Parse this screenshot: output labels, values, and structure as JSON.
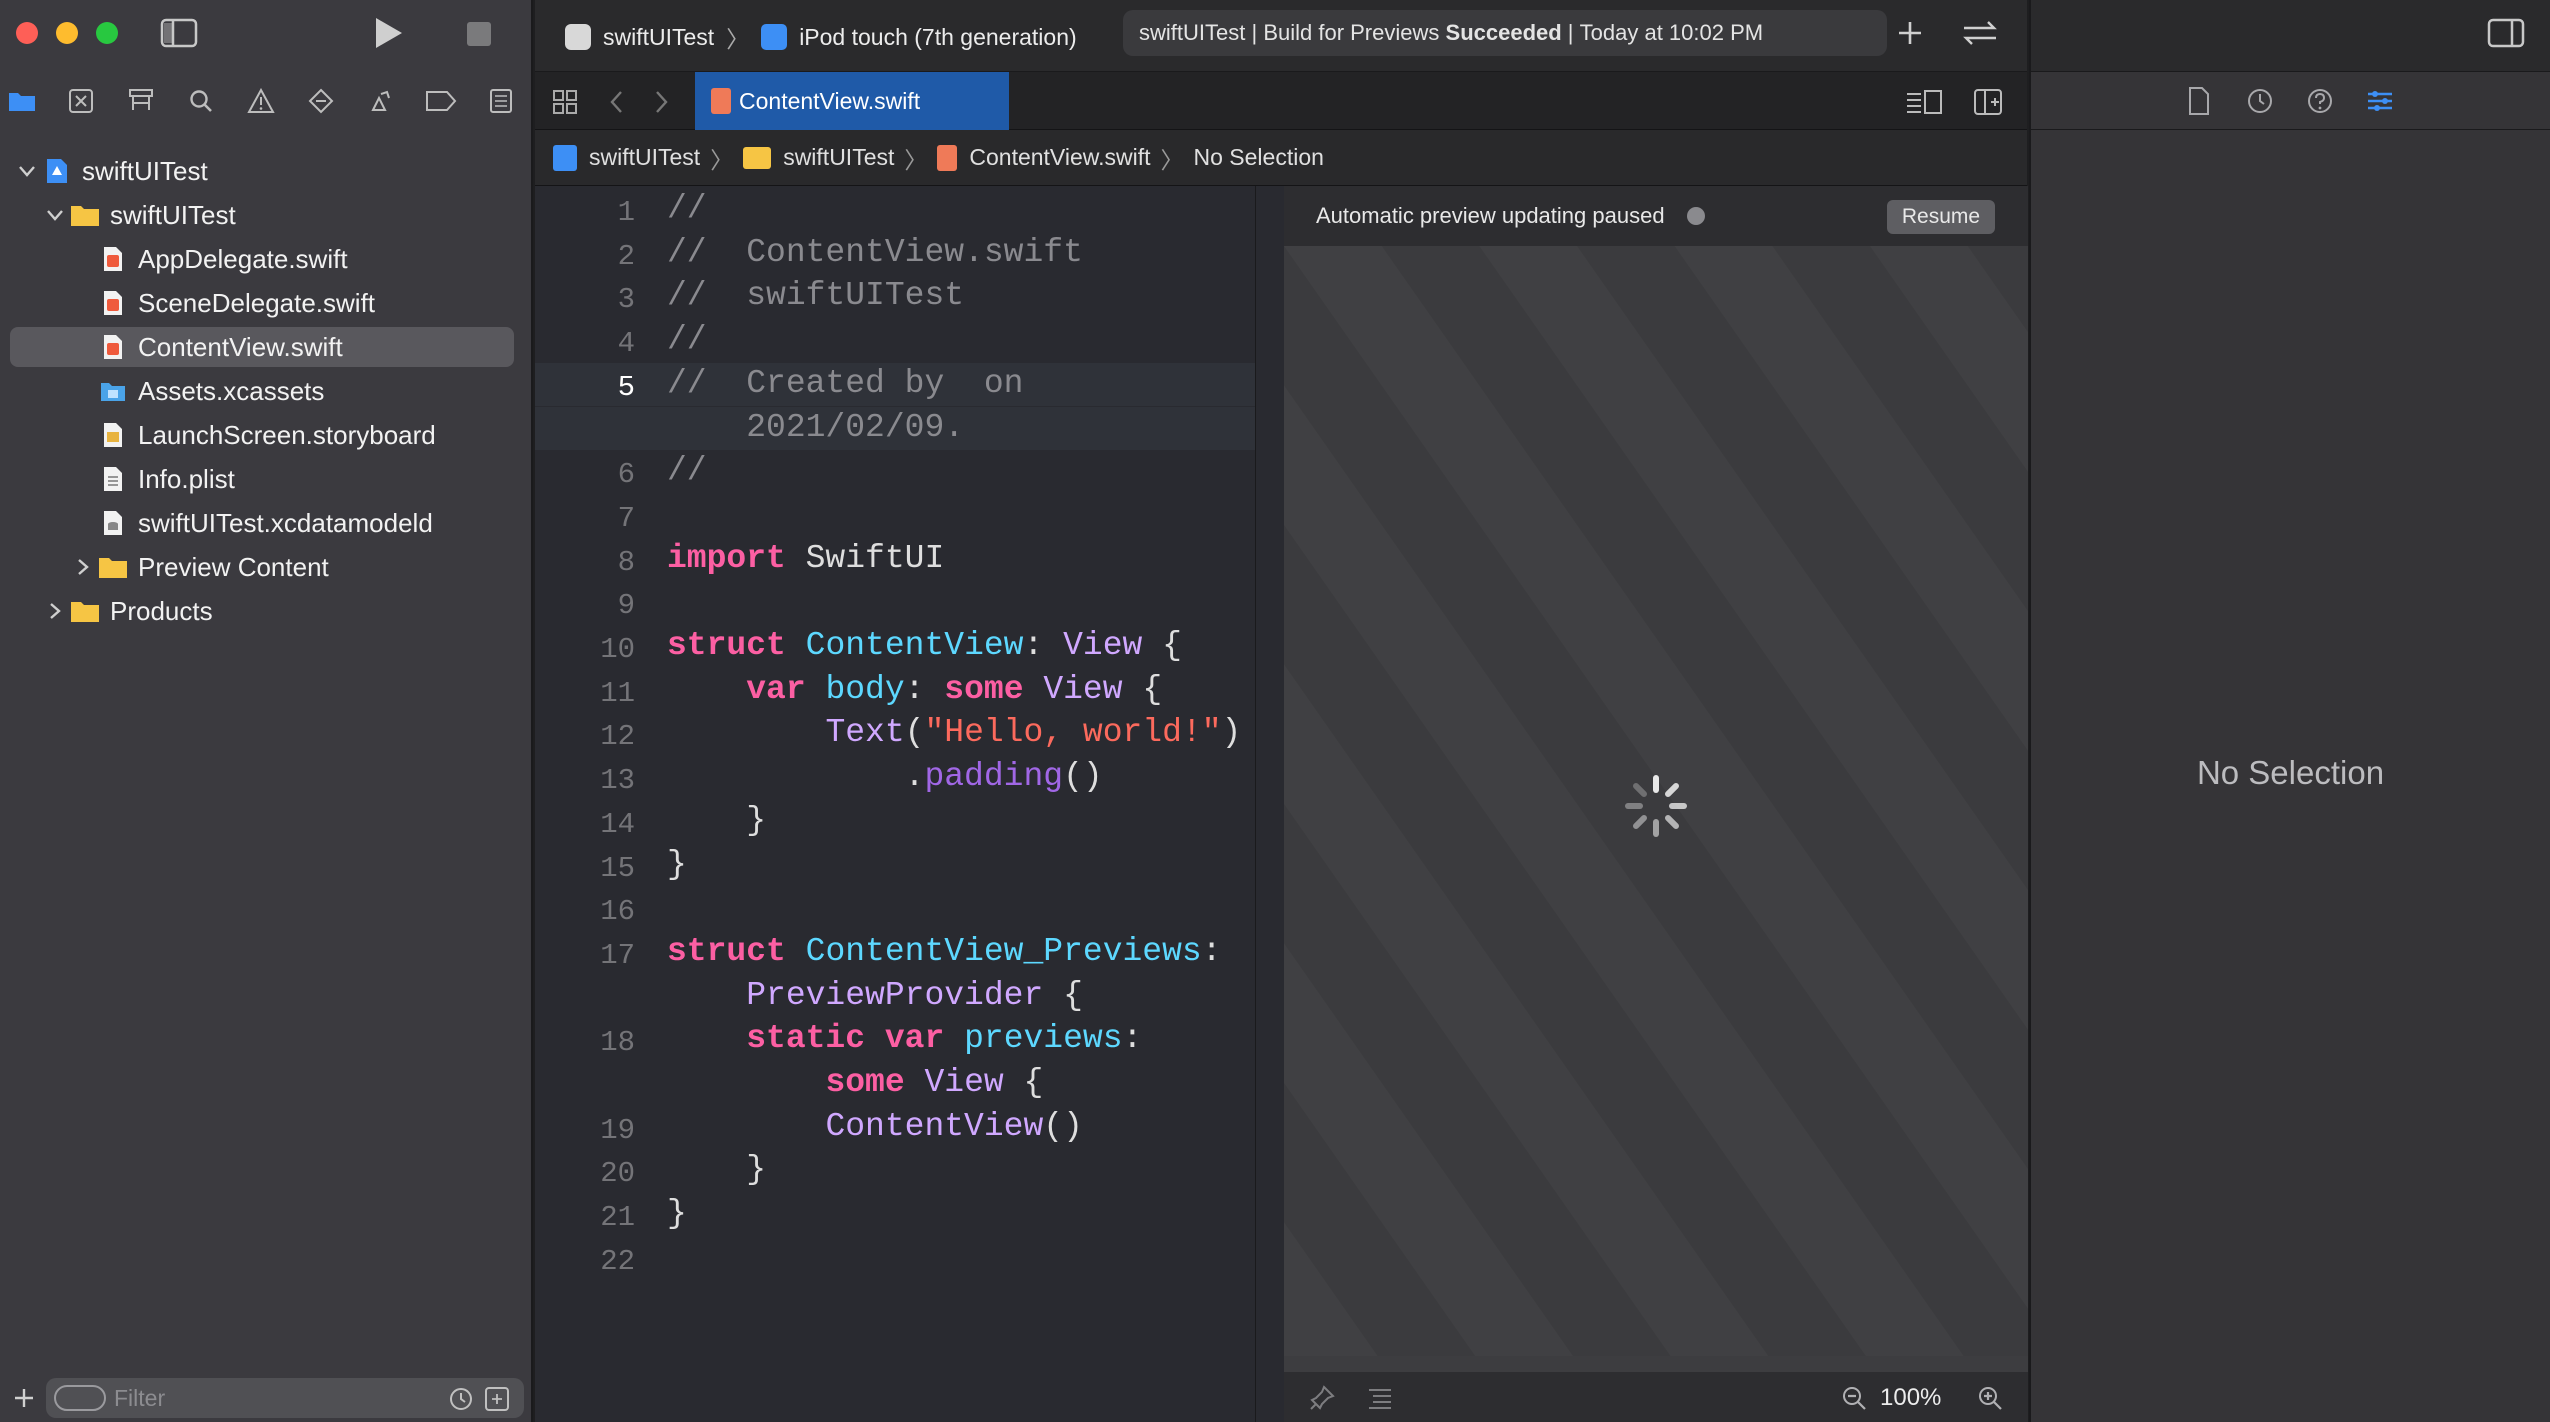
{
  "toolbar": {
    "scheme": "swiftUITest",
    "device": "iPod touch (7th generation)",
    "status_project": "swiftUITest",
    "status_action": "Build for Previews",
    "status_result": "Succeeded",
    "status_time": "Today at 10:02 PM"
  },
  "navigator": {
    "tree": [
      {
        "label": "swiftUITest",
        "kind": "project",
        "level": 0,
        "expanded": true
      },
      {
        "label": "swiftUITest",
        "kind": "folder",
        "level": 1,
        "expanded": true
      },
      {
        "label": "AppDelegate.swift",
        "kind": "swift",
        "level": 2
      },
      {
        "label": "SceneDelegate.swift",
        "kind": "swift",
        "level": 2
      },
      {
        "label": "ContentView.swift",
        "kind": "swift",
        "level": 2,
        "selected": true
      },
      {
        "label": "Assets.xcassets",
        "kind": "assets",
        "level": 2
      },
      {
        "label": "LaunchScreen.storyboard",
        "kind": "storyboard",
        "level": 2
      },
      {
        "label": "Info.plist",
        "kind": "plist",
        "level": 2
      },
      {
        "label": "swiftUITest.xcdatamodeld",
        "kind": "datamodel",
        "level": 2
      },
      {
        "label": "Preview Content",
        "kind": "folder",
        "level": 2,
        "expanded": false
      },
      {
        "label": "Products",
        "kind": "folder",
        "level": 1,
        "expanded": false
      }
    ],
    "filter_placeholder": "Filter"
  },
  "editor": {
    "tab_label": "ContentView.swift",
    "jump_bar": [
      "swiftUITest",
      "swiftUITest",
      "ContentView.swift",
      "No Selection"
    ],
    "current_line": 5,
    "lines": [
      {
        "n": "1",
        "tokens": [
          [
            "cm",
            "//"
          ]
        ]
      },
      {
        "n": "2",
        "tokens": [
          [
            "cm",
            "//  ContentView.swift"
          ]
        ]
      },
      {
        "n": "3",
        "tokens": [
          [
            "cm",
            "//  swiftUITest"
          ]
        ]
      },
      {
        "n": "4",
        "tokens": [
          [
            "cm",
            "//"
          ]
        ]
      },
      {
        "n": "5",
        "tokens": [
          [
            "cm",
            "//  Created by  on"
          ]
        ]
      },
      {
        "n": "",
        "tokens": [
          [
            "cm",
            "    2021/02/09."
          ]
        ]
      },
      {
        "n": "6",
        "tokens": [
          [
            "cm",
            "//"
          ]
        ]
      },
      {
        "n": "7",
        "tokens": []
      },
      {
        "n": "8",
        "tokens": [
          [
            "kw",
            "import"
          ],
          [
            "pl",
            " SwiftUI"
          ]
        ]
      },
      {
        "n": "9",
        "tokens": []
      },
      {
        "n": "10",
        "tokens": [
          [
            "kw",
            "struct"
          ],
          [
            "pl",
            " "
          ],
          [
            "tn",
            "ContentView"
          ],
          [
            "pl",
            ": "
          ],
          [
            "ty",
            "View"
          ],
          [
            "pl",
            " {"
          ]
        ]
      },
      {
        "n": "11",
        "tokens": [
          [
            "pl",
            "    "
          ],
          [
            "kw",
            "var"
          ],
          [
            "pl",
            " "
          ],
          [
            "tn",
            "body"
          ],
          [
            "pl",
            ": "
          ],
          [
            "kw",
            "some"
          ],
          [
            "pl",
            " "
          ],
          [
            "ty",
            "View"
          ],
          [
            "pl",
            " {"
          ]
        ]
      },
      {
        "n": "12",
        "tokens": [
          [
            "pl",
            "        "
          ],
          [
            "ty",
            "Text"
          ],
          [
            "pl",
            "("
          ],
          [
            "st",
            "\"Hello, world!\""
          ],
          [
            "pl",
            ")"
          ]
        ]
      },
      {
        "n": "13",
        "tokens": [
          [
            "pl",
            "            ."
          ],
          [
            "fn",
            "padding"
          ],
          [
            "pl",
            "()"
          ]
        ]
      },
      {
        "n": "14",
        "tokens": [
          [
            "pl",
            "    }"
          ]
        ]
      },
      {
        "n": "15",
        "tokens": [
          [
            "pl",
            "}"
          ]
        ]
      },
      {
        "n": "16",
        "tokens": []
      },
      {
        "n": "17",
        "tokens": [
          [
            "kw",
            "struct"
          ],
          [
            "pl",
            " "
          ],
          [
            "tn",
            "ContentView_Previews"
          ],
          [
            "pl",
            ":"
          ]
        ]
      },
      {
        "n": "",
        "tokens": [
          [
            "pl",
            "    "
          ],
          [
            "ty",
            "PreviewProvider"
          ],
          [
            "pl",
            " {"
          ]
        ]
      },
      {
        "n": "18",
        "tokens": [
          [
            "pl",
            "    "
          ],
          [
            "kw",
            "static"
          ],
          [
            "pl",
            " "
          ],
          [
            "kw",
            "var"
          ],
          [
            "pl",
            " "
          ],
          [
            "tn",
            "previews"
          ],
          [
            "pl",
            ":"
          ]
        ]
      },
      {
        "n": "",
        "tokens": [
          [
            "pl",
            "        "
          ],
          [
            "kw",
            "some"
          ],
          [
            "pl",
            " "
          ],
          [
            "ty",
            "View"
          ],
          [
            "pl",
            " {"
          ]
        ]
      },
      {
        "n": "19",
        "tokens": [
          [
            "pl",
            "        "
          ],
          [
            "ty",
            "ContentView"
          ],
          [
            "pl",
            "()"
          ]
        ]
      },
      {
        "n": "20",
        "tokens": [
          [
            "pl",
            "    }"
          ]
        ]
      },
      {
        "n": "21",
        "tokens": [
          [
            "pl",
            "}"
          ]
        ]
      },
      {
        "n": "22",
        "tokens": []
      }
    ]
  },
  "canvas": {
    "banner": "Automatic preview updating paused",
    "resume_label": "Resume",
    "zoom": "100%"
  },
  "inspector": {
    "empty_label": "No Selection"
  }
}
